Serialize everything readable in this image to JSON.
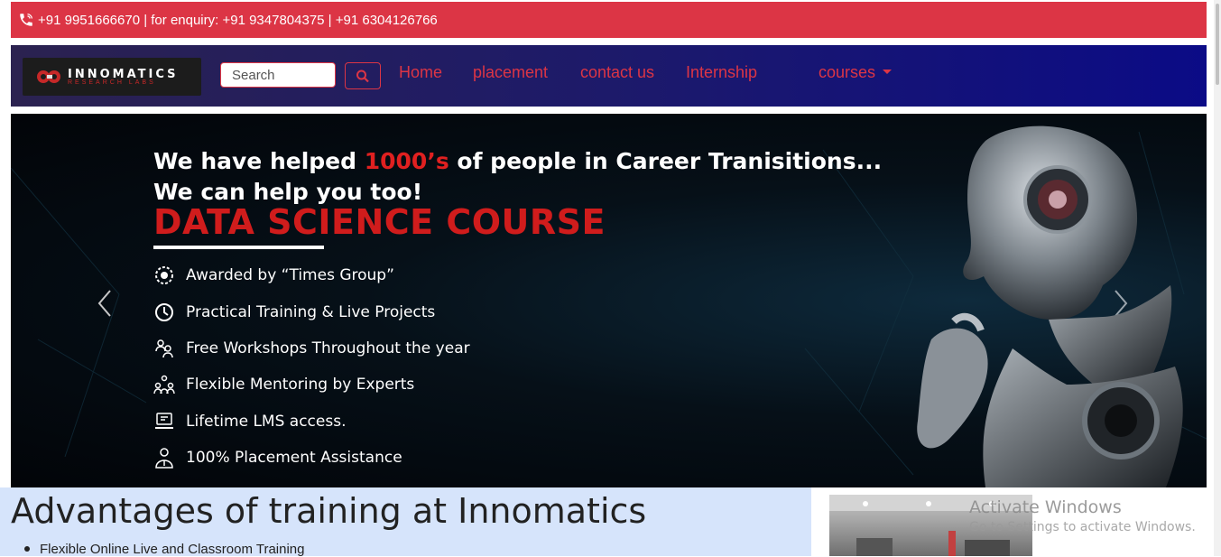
{
  "topbar": {
    "contact_text": "+91 9951666670 | for enquiry: +91 9347804375 | +91 6304126766",
    "bg_color": "#dc3545"
  },
  "navbar": {
    "logo_text": "INNOMATICS",
    "logo_subtext": "RESEARCH LABS",
    "search_placeholder": "Search",
    "links": [
      {
        "label": "Home"
      },
      {
        "label": "placement"
      },
      {
        "label": "contact us"
      },
      {
        "label": "Internship"
      },
      {
        "label": "courses"
      }
    ],
    "link_color": "#dc3545"
  },
  "hero": {
    "line1_pre": "We have helped ",
    "line1_highlight": "1000’s",
    "line1_post": " of people in Career Tranisitions...",
    "line2": "We can help you too!",
    "line3": "DATA SCIENCE COURSE",
    "features": [
      {
        "text": "Awarded by “Times Group”",
        "icon": "award-badge-icon"
      },
      {
        "text": "Practical Training & Live Projects",
        "icon": "clock-icon"
      },
      {
        "text": "Free Workshops Throughout the year",
        "icon": "workshop-people-icon"
      },
      {
        "text": "Flexible Mentoring by Experts",
        "icon": "mentoring-group-icon"
      },
      {
        "text": "Lifetime LMS  access.",
        "icon": "lms-laptop-icon"
      },
      {
        "text": "100% Placement Assistance",
        "icon": "placement-person-icon"
      }
    ],
    "highlight_color": "#e02020"
  },
  "advantages": {
    "heading": "Advantages of training at Innomatics",
    "items": [
      "Flexible Online Live and Classroom Training"
    ]
  },
  "watermark": {
    "line1": "Activate Windows",
    "line2": "Go to Settings to activate Windows."
  }
}
